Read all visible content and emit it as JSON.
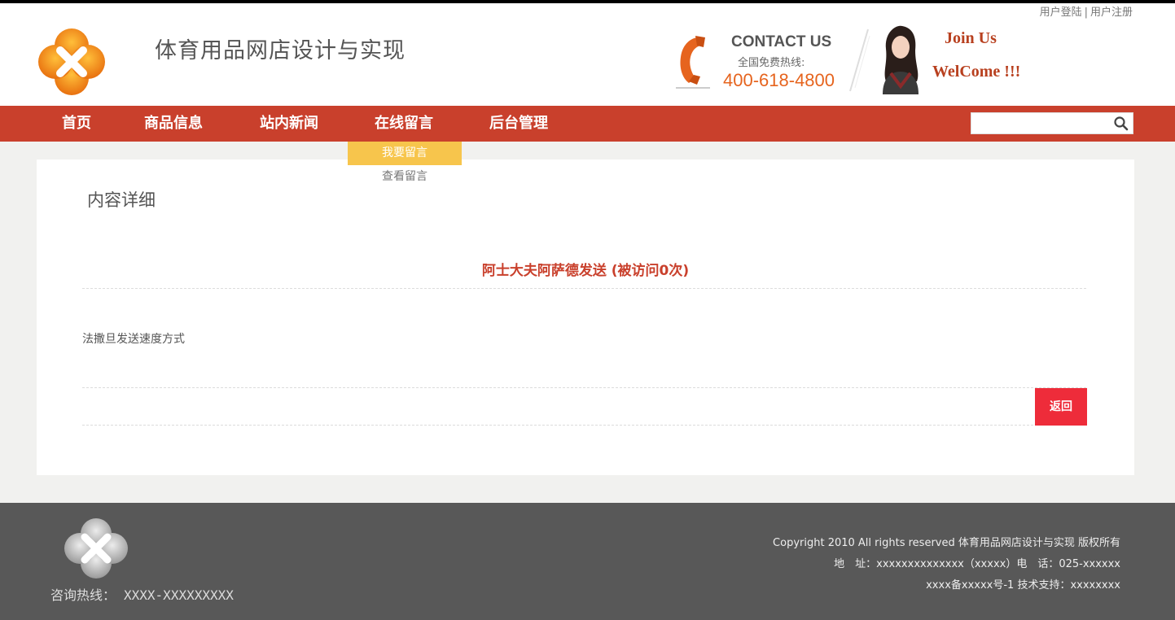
{
  "header": {
    "login": "用户登陆",
    "separator": "|",
    "register": "用户注册",
    "site_title": "体育用品网店设计与实现",
    "contact_label": "CONTACT US",
    "hotline_label": "全国免费热线:",
    "phone": "400-618-4800",
    "join_us": "Join Us",
    "welcome": "WelCome !!!"
  },
  "nav": {
    "items": [
      "首页",
      "商品信息",
      "站内新闻",
      "在线留言",
      "后台管理"
    ],
    "search_placeholder": ""
  },
  "dropdown": {
    "items": [
      "我要留言",
      "查看留言"
    ]
  },
  "content": {
    "section_title": "内容详细",
    "article_title": "阿士大夫阿萨德发送 (被访问0次)",
    "article_body": "法撒旦发送速度方式",
    "back_button": "返回"
  },
  "footer": {
    "hotline_label": "咨询热线：",
    "hotline_number": "XXXX-XXXXXXXXX",
    "copyright": "Copyright 2010 All rights reserved 体育用品网店设计与实现 版权所有",
    "address": "地　址：xxxxxxxxxxxxxx（xxxxx）电　话：025-xxxxxx",
    "icp": "xxxx备xxxxx号-1 技术支持：xxxxxxxx"
  },
  "colors": {
    "nav_bg": "#c9402c",
    "accent_orange": "#e6641e",
    "dropdown_active": "#f7c54c",
    "back_button": "#ee2c3a",
    "footer_bg": "#585858"
  },
  "icons": [
    "logo-flower",
    "phone-icon",
    "search-icon"
  ]
}
